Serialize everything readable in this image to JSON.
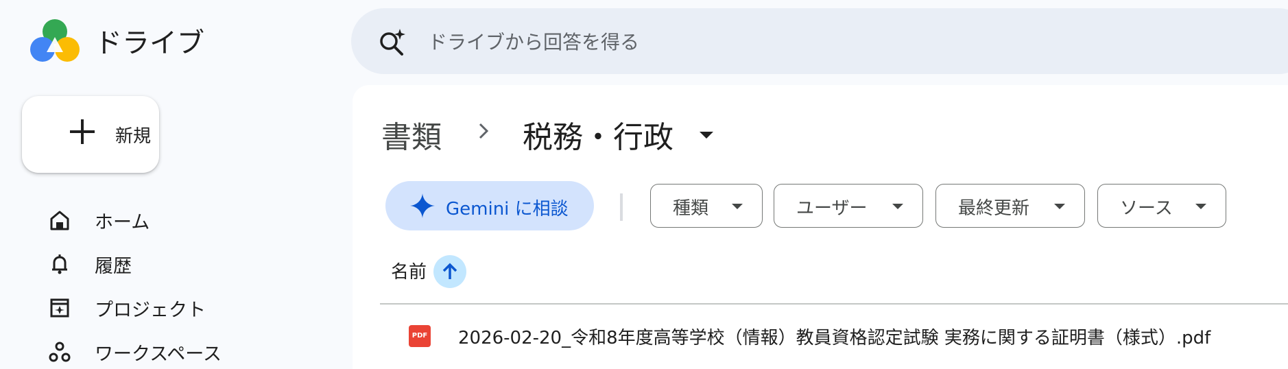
{
  "app": {
    "title": "ドライブ"
  },
  "sidebar": {
    "new_label": "新規",
    "items": [
      {
        "label": "ホーム",
        "icon": "home-icon"
      },
      {
        "label": "履歴",
        "icon": "bell-icon"
      },
      {
        "label": "プロジェクト",
        "icon": "project-icon"
      },
      {
        "label": "ワークスペース",
        "icon": "workspaces-icon"
      }
    ]
  },
  "search": {
    "placeholder": "ドライブから回答を得る",
    "icon": "gemini-search-icon"
  },
  "breadcrumb": {
    "root": "書類",
    "current": "税務・行政"
  },
  "toolbar": {
    "gemini_label": "Gemini に相談",
    "chips": [
      {
        "label": "種類"
      },
      {
        "label": "ユーザー"
      },
      {
        "label": "最終更新"
      },
      {
        "label": "ソース"
      }
    ]
  },
  "list": {
    "column_name": "名前",
    "files": [
      {
        "name": "2026-02-20_令和8年度高等学校（情報）教員資格認定試験 実務に関する証明書（様式）.pdf",
        "type_label": "PDF"
      }
    ]
  },
  "colors": {
    "accent": "#0b57d0",
    "gemini_bg": "#d3e3fd",
    "sort_bg": "#c2e7ff",
    "pdf_red": "#ea4335",
    "search_bg": "#e9eef6"
  }
}
